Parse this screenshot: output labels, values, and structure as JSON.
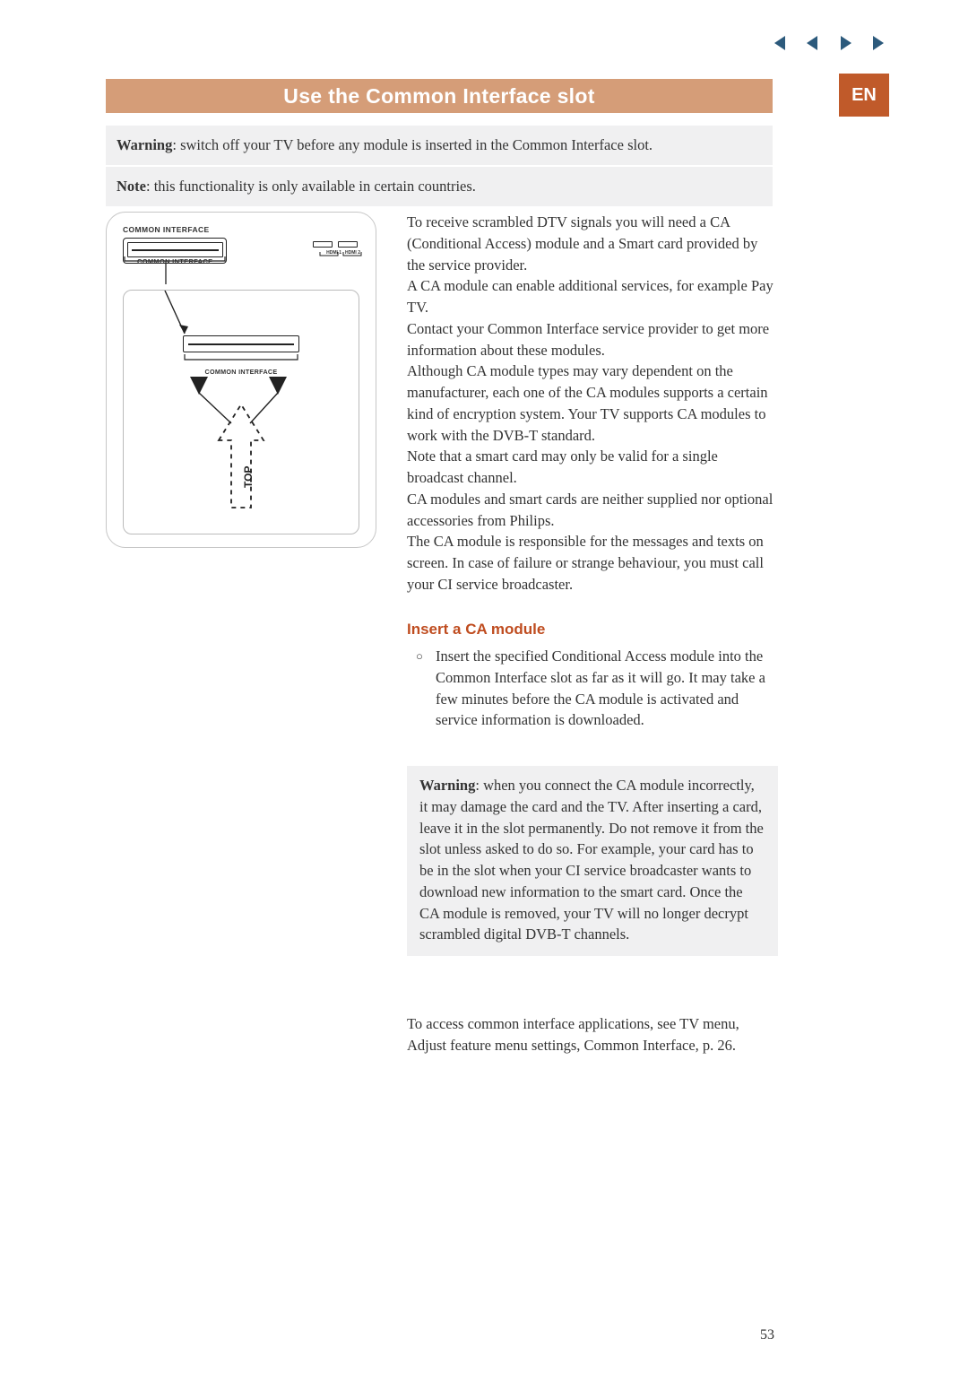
{
  "header": {
    "title": "Use the Common Interface slot",
    "lang_badge": "EN"
  },
  "warning1": {
    "bold": "Warning",
    "text": ": switch off your TV before any module is inserted in the Common Interface slot."
  },
  "note": {
    "bold": "Note",
    "text": ": this functionality is only available in certain countries."
  },
  "illustration": {
    "label_top": "COMMON INTERFACE",
    "label_sub": "COMMON INTERFACE",
    "label_inner": "COMMON INTERFACE",
    "hdmi1": "HDMI 1",
    "hdmi2": "HDMI 2",
    "top_label": "TOP"
  },
  "body": {
    "text": "To receive scrambled DTV signals you will need a CA (Conditional Access) module and a Smart card provided by the service provider.\nA CA module can enable additional services, for example Pay TV.\nContact your Common Interface service provider to get more information about these modules.\nAlthough CA module types may vary dependent on the manufacturer, each one of the CA modules supports a certain kind of encryption system. Your TV supports CA modules to work with the DVB-T standard.\nNote that a smart card may only be valid for a single broadcast channel.\nCA modules and smart cards are neither supplied nor optional accessories from Philips.\nThe CA module is responsible for the messages and texts on screen. In case of failure or strange behaviour, you must call your CI service broadcaster."
  },
  "insert_section": {
    "heading": "Insert a CA module",
    "item": "Insert the specified Conditional Access module into the Common Interface slot as far as it will go. It may take a few minutes before the CA module is activated and service information is downloaded."
  },
  "warning2": {
    "bold": "Warning",
    "text": ": when you connect the CA module incorrectly, it may damage the card and the TV. After inserting a card, leave it in the slot permanently. Do not remove it from the slot unless asked to do so. For example,  your card has to be in the slot when your CI service broadcaster wants to download new information to the smart card. Once the CA module is removed, your TV will no longer decrypt scrambled digital DVB-T channels."
  },
  "closing": {
    "text": "To access common interface applications, see TV menu, Adjust feature menu settings, Common Interface, p. 26."
  },
  "page_number": "53",
  "nav": {
    "first": "first-page",
    "prev": "previous-page",
    "next": "next-page",
    "last": "last-page"
  }
}
